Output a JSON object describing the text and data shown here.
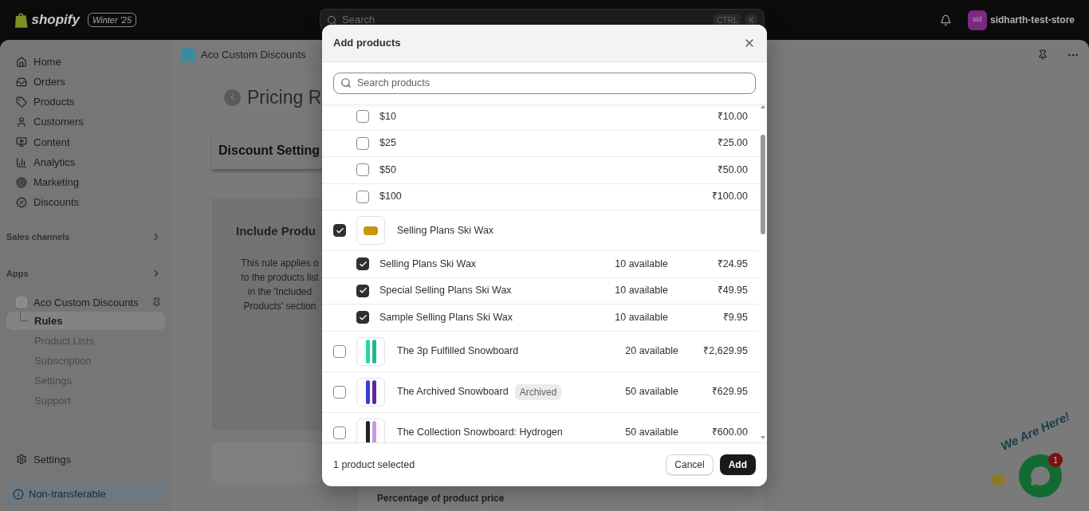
{
  "topbar": {
    "logo_text": "shopify",
    "edition_badge": "Winter '25",
    "search": {
      "placeholder": "Search",
      "shortcut": [
        "CTRL",
        "K"
      ]
    },
    "store": {
      "avatar": "sid",
      "name": "sidharth-test-store"
    }
  },
  "sidebar": {
    "nav": [
      {
        "label": "Home"
      },
      {
        "label": "Orders"
      },
      {
        "label": "Products"
      },
      {
        "label": "Customers"
      },
      {
        "label": "Content"
      },
      {
        "label": "Analytics"
      },
      {
        "label": "Marketing"
      },
      {
        "label": "Discounts"
      }
    ],
    "sections": [
      {
        "label": "Sales channels"
      },
      {
        "label": "Apps"
      }
    ],
    "app": {
      "name": "Aco Custom Discounts",
      "pages": [
        {
          "label": "Rules",
          "selected": true
        },
        {
          "label": "Product Lists",
          "selected": false
        },
        {
          "label": "Subscription",
          "selected": false
        },
        {
          "label": "Settings",
          "selected": false
        },
        {
          "label": "Support",
          "selected": false
        }
      ]
    },
    "settings": "Settings",
    "plan_badge": "Non-transferable"
  },
  "page": {
    "app_title": "Aco Custom Discounts",
    "title": "Pricing R",
    "settings_card": "Discount Setting",
    "include_card": {
      "heading": "Include Produ",
      "lines": [
        "This rule applies o",
        "to the products list",
        "in the 'Included",
        "Products' section"
      ]
    },
    "bottom_card": "Percentage of product price"
  },
  "modal": {
    "title": "Add products",
    "search": {
      "placeholder": "Search products"
    },
    "rows": [
      {
        "kind": "variant",
        "title": "$10",
        "price": "₹10.00",
        "checked": false
      },
      {
        "kind": "variant",
        "title": "$25",
        "price": "₹25.00",
        "checked": false
      },
      {
        "kind": "variant",
        "title": "$50",
        "price": "₹50.00",
        "checked": false
      },
      {
        "kind": "variant",
        "title": "$100",
        "price": "₹100.00",
        "checked": false
      },
      {
        "kind": "product",
        "title": "Selling Plans Ski Wax",
        "checked": true
      },
      {
        "kind": "variant",
        "title": "Selling Plans Ski Wax",
        "availability": "10 available",
        "price": "₹24.95",
        "checked": true
      },
      {
        "kind": "variant",
        "title": "Special Selling Plans Ski Wax",
        "availability": "10 available",
        "price": "₹49.95",
        "checked": true
      },
      {
        "kind": "variant",
        "title": "Sample Selling Plans Ski Wax",
        "availability": "10 available",
        "price": "₹9.95",
        "checked": true
      },
      {
        "kind": "product",
        "title": "The 3p Fulfilled Snowboard",
        "availability": "20 available",
        "price": "₹2,629.95",
        "checked": false
      },
      {
        "kind": "product",
        "title": "The Archived Snowboard",
        "badge": "Archived",
        "availability": "50 available",
        "price": "₹629.95",
        "checked": false
      },
      {
        "kind": "product",
        "title": "The Collection Snowboard: Hydrogen",
        "availability": "50 available",
        "price": "₹600.00",
        "checked": false
      }
    ],
    "footer": {
      "status": "1 product selected",
      "cancel": "Cancel",
      "confirm": "Add"
    }
  },
  "chat_widget": {
    "label": "We Are Here!",
    "badge": "1"
  }
}
